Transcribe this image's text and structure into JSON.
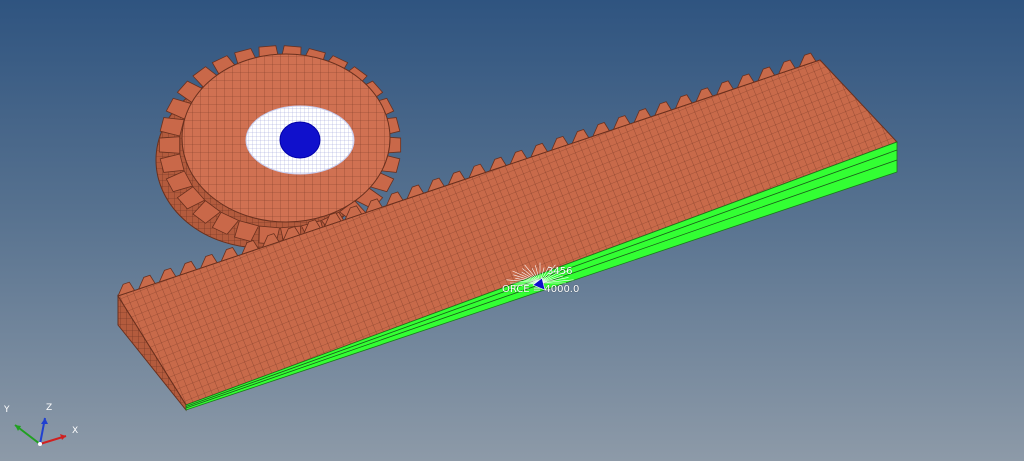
{
  "viewport": {
    "background_top": "#2f5480",
    "background_bottom": "#8d9aa8"
  },
  "model": {
    "mesh_color": "#c86a4a",
    "constraint_color": "#33ff33",
    "bore_fill_color": "#1010cc"
  },
  "annotations": {
    "node_id": "3456",
    "force_label": "ORCE = 4000.0"
  },
  "triad": {
    "x_label": "X",
    "y_label": "Y",
    "z_label": "Z"
  }
}
